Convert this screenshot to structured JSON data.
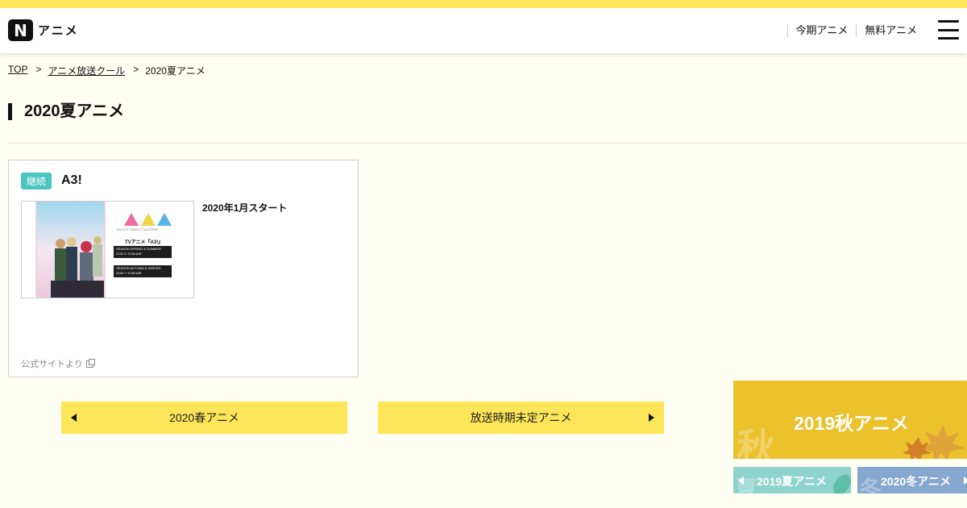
{
  "header": {
    "logo_letter": "N",
    "logo_text": "アニメ",
    "nav": [
      "今期アニメ",
      "無料アニメ"
    ]
  },
  "breadcrumb": {
    "items": [
      "TOP",
      "アニメ放送クール"
    ],
    "current": "2020夏アニメ",
    "separator": ">"
  },
  "page_title": "2020夏アニメ",
  "card": {
    "badge": "継続",
    "title": "A3!",
    "start": "2020年1月スタート",
    "source": "公式サイトより",
    "thumb_heading": "TVアニメ『A3!』",
    "thumb_logo_caption": "A3! ACT! ADDICT! ACTORS!",
    "thumb_box1": [
      "SEASON SPRING & SUMMER",
      "2020.1~3 ON AIR"
    ],
    "thumb_box2": [
      "SEASON AUTUMN & WINTER",
      "2020.7~9 ON AIR"
    ]
  },
  "pager": {
    "prev": "2020春アニメ",
    "next": "放送時期未定アニメ"
  },
  "season_nav": {
    "main": {
      "kanji": "秋",
      "label": "2019秋アニメ",
      "color": "#ebc12c"
    },
    "sub": [
      {
        "kanji": "夏",
        "label": "2019夏アニメ",
        "color": "#8ed3cc"
      },
      {
        "kanji": "冬",
        "label": "2020冬アニメ",
        "color": "#86a8cf"
      }
    ]
  },
  "colors": {
    "accent": "#fce558",
    "topbar": "#fce75a",
    "badge": "#4cc4c0"
  }
}
